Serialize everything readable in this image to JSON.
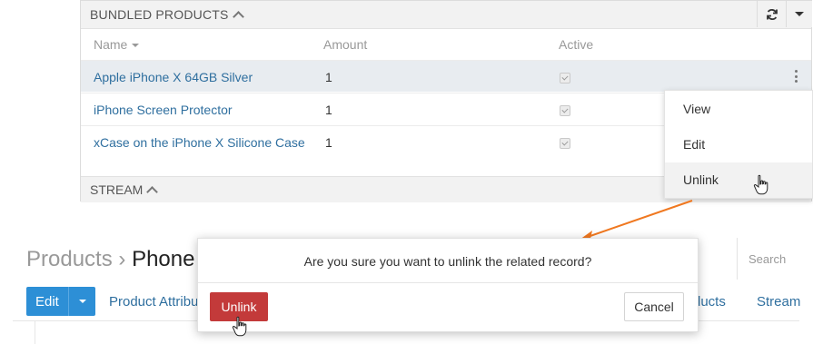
{
  "bundled_panel": {
    "title": "BUNDLED PRODUCTS",
    "columns": {
      "name": "Name",
      "amount": "Amount",
      "active": "Active"
    },
    "rows": [
      {
        "name": "Apple iPhone X 64GB Silver",
        "amount": "1",
        "active": true
      },
      {
        "name": "iPhone Screen Protector",
        "amount": "1",
        "active": true
      },
      {
        "name": "xCase on the iPhone X Silicone Case",
        "amount": "1",
        "active": true
      }
    ]
  },
  "stream_panel": {
    "title": "STREAM"
  },
  "row_menu": {
    "items": [
      "View",
      "Edit",
      "Unlink"
    ],
    "highlighted": "Unlink"
  },
  "breadcrumb": {
    "parent": "Products",
    "separator": "›",
    "current": "Phone"
  },
  "search": {
    "placeholder": "Search"
  },
  "toolbar": {
    "edit_label": "Edit",
    "tabs": {
      "product_attributes": "Product Attribu",
      "products": "ducts",
      "stream": "Stream"
    }
  },
  "confirm_dialog": {
    "message": "Are you sure you want to unlink the related record?",
    "confirm_label": "Unlink",
    "cancel_label": "Cancel"
  },
  "colors": {
    "link": "#2f6f9f",
    "primary": "#2d8fd6",
    "danger": "#c33a3a",
    "annotation_arrow": "#f07820"
  }
}
